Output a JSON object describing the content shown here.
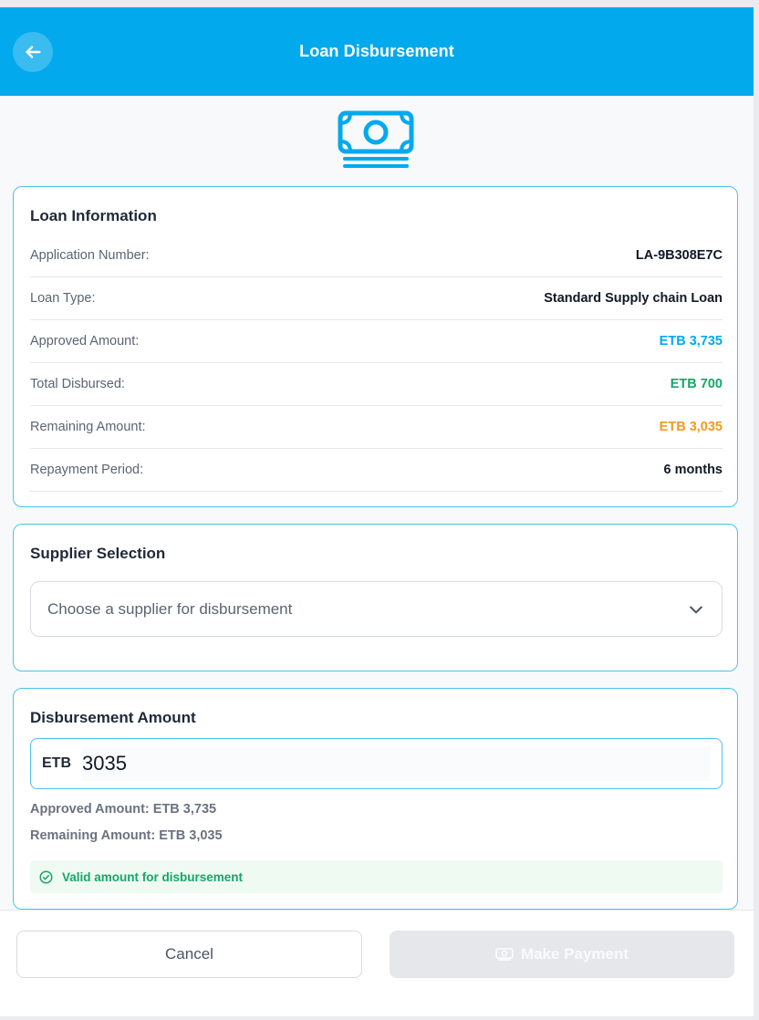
{
  "header": {
    "title": "Loan Disbursement",
    "back_icon": "arrow-left-icon",
    "color": "#03a9ed"
  },
  "hero": {
    "icon": "banknote-icon"
  },
  "loan_info": {
    "title": "Loan Information",
    "rows": [
      {
        "label": "Application Number:",
        "value": "LA-9B308E7C",
        "color": "#111827"
      },
      {
        "label": "Loan Type:",
        "value": "Standard Supply chain Loan",
        "color": "#111827"
      },
      {
        "label": "Approved Amount:",
        "value": "ETB 3,735",
        "color": "#03a9ed"
      },
      {
        "label": "Total Disbursed:",
        "value": "ETB 700",
        "color": "#17a668"
      },
      {
        "label": "Remaining Amount:",
        "value": "ETB 3,035",
        "color": "#f29a1f"
      },
      {
        "label": "Repayment Period:",
        "value": "6 months",
        "color": "#111827"
      }
    ]
  },
  "supplier": {
    "title": "Supplier Selection",
    "select_placeholder": "Choose a supplier for disbursement"
  },
  "amount": {
    "title": "Disbursement Amount",
    "currency": "ETB",
    "value": "3035",
    "approved_note": "Approved Amount: ETB 3,735",
    "remaining_note": "Remaining Amount: ETB 3,035",
    "valid_message": "Valid amount for disbursement"
  },
  "footer": {
    "cancel_label": "Cancel",
    "pay_label": "Make Payment"
  }
}
